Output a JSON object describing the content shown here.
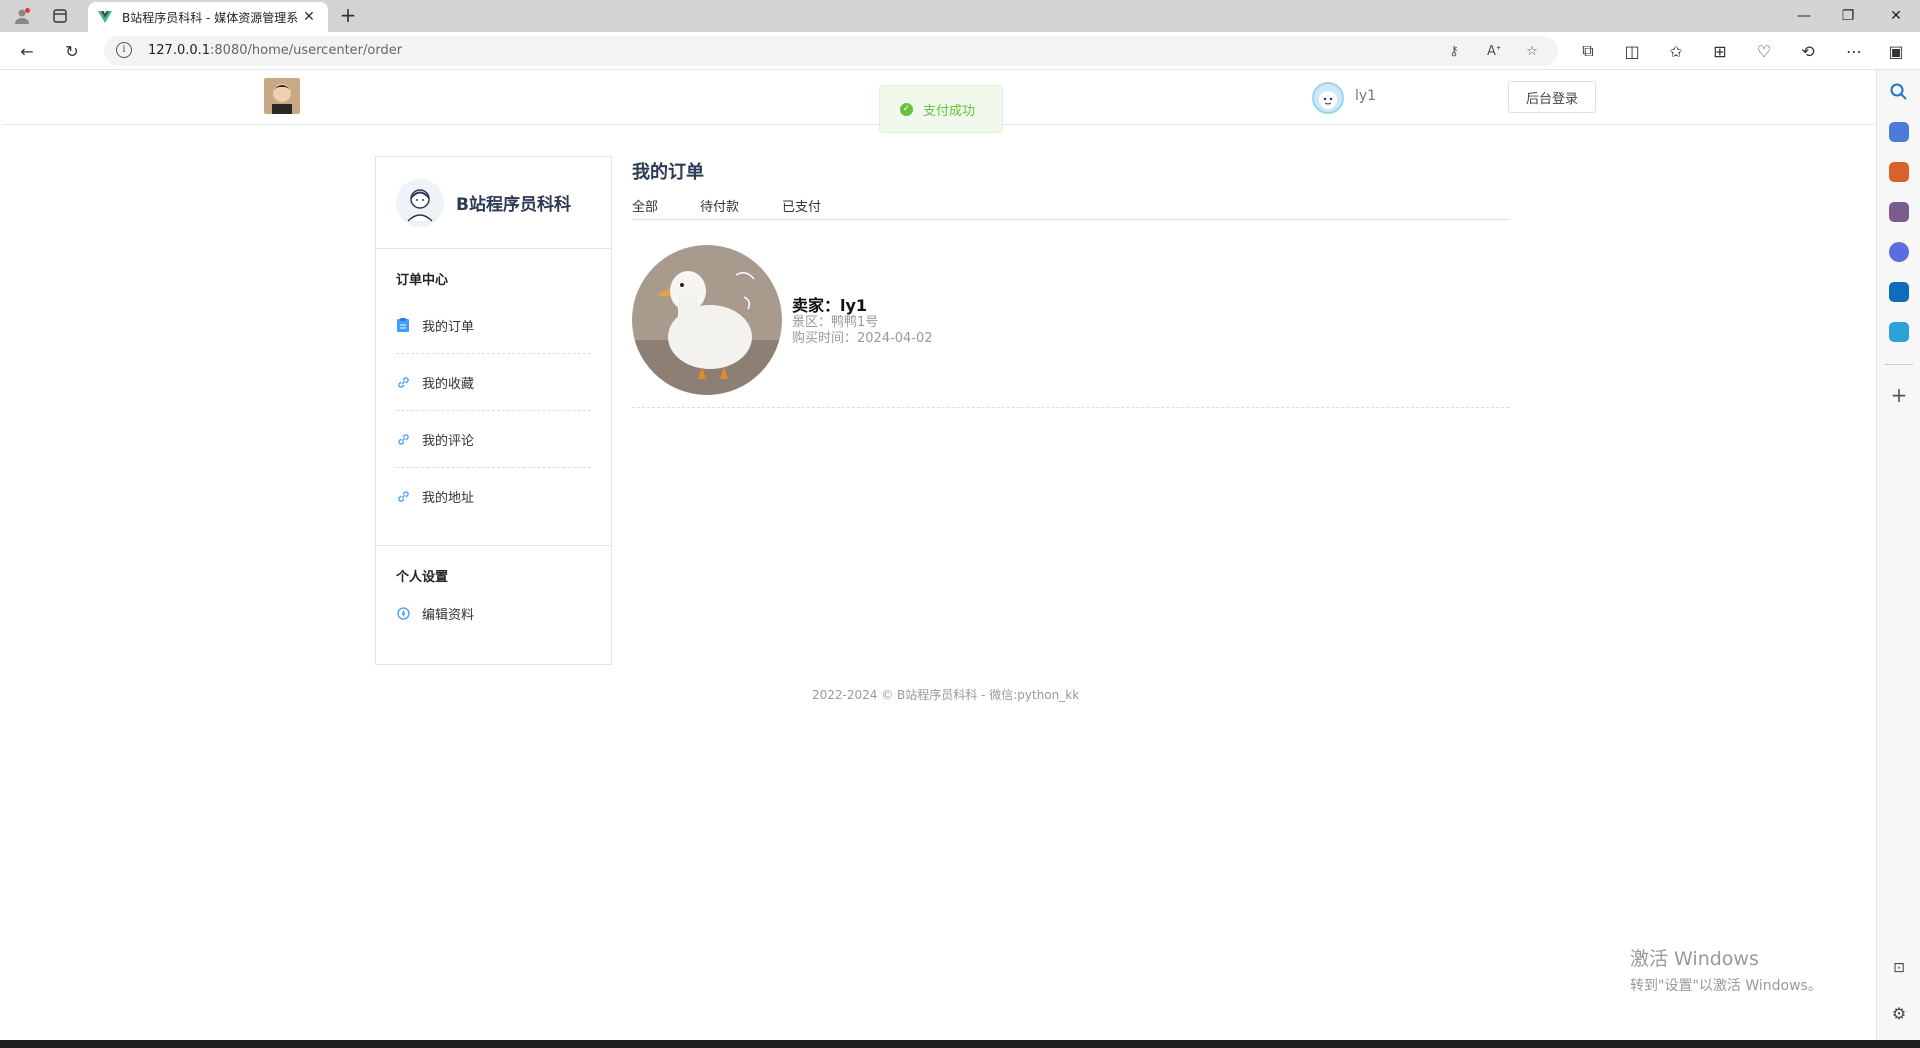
{
  "browser": {
    "tab_title": "B站程序员科科 - 媒体资源管理系",
    "url_host": "127.0.0.1",
    "url_rest": ":8080/home/usercenter/order"
  },
  "header": {
    "toast": "支付成功",
    "username": "ly1",
    "admin_login": "后台登录"
  },
  "sidebar": {
    "brand": "B站程序员科科",
    "section1_title": "订单中心",
    "items": [
      {
        "label": "我的订单",
        "icon": "clipboard-icon"
      },
      {
        "label": "我的收藏",
        "icon": "link-icon"
      },
      {
        "label": "我的评论",
        "icon": "link-icon"
      },
      {
        "label": "我的地址",
        "icon": "link-icon"
      }
    ],
    "section2_title": "个人设置",
    "settings_items": [
      {
        "label": "编辑资料",
        "icon": "compass-icon"
      }
    ]
  },
  "main": {
    "title": "我的订单",
    "tabs": [
      "全部",
      "待付款",
      "已支付"
    ],
    "orders": [
      {
        "seller": "卖家：ly1",
        "area": "景区：鸭鸭1号",
        "time": "购买时间：2024-04-02"
      }
    ]
  },
  "footer": {
    "text": "2022-2024 © B站程序员科科 - 微信:python_kk"
  },
  "watermark": {
    "line1": "激活 Windows",
    "line2": "转到\"设置\"以激活 Windows。"
  },
  "colors": {
    "accent": "#409eff",
    "success": "#67c23a",
    "title": "#2b3a55"
  }
}
